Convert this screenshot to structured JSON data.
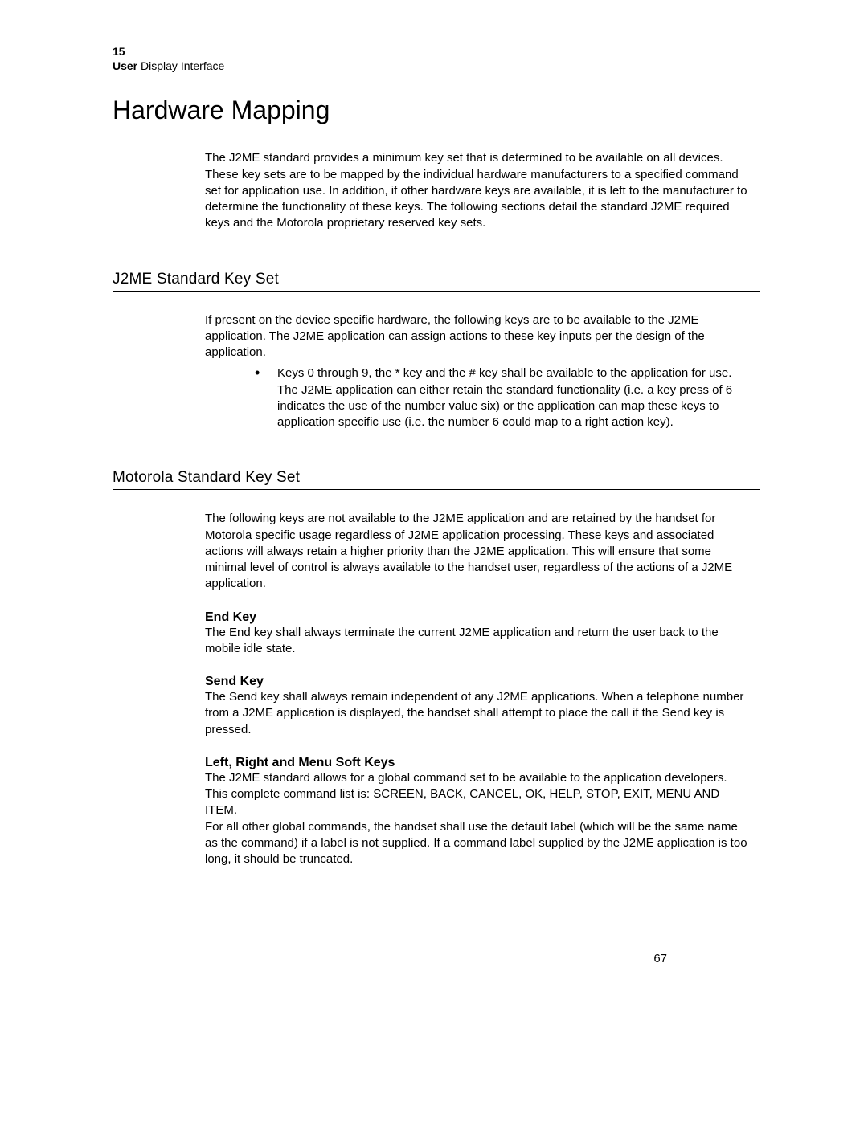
{
  "header": {
    "chapter_number": "15",
    "chapter_title_bold": "User",
    "chapter_title_rest": " Display Interface"
  },
  "title": "Hardware Mapping",
  "intro": "The J2ME standard provides a minimum key set that is determined to be available on all devices. These key sets are to be mapped by the individual hardware manufacturers to a specified command set for application use. In addition, if other hardware keys are available, it is left to the manufacturer to determine the functionality of these keys. The following sections detail the standard J2ME required keys and the Motorola proprietary reserved key sets.",
  "section_j2me": {
    "heading": "J2ME Standard Key Set",
    "para": "If present on the device specific hardware, the following keys are to be available to the J2ME application. The J2ME application can assign actions to these key inputs per the design of the application.",
    "bullet": "Keys 0 through 9, the * key and the # key shall be available to the application for use. The J2ME application can either retain the standard functionality (i.e. a key press of 6 indicates the use of the number value six) or the application can map these keys to application specific use (i.e. the number 6 could map to a right action key)."
  },
  "section_moto": {
    "heading": "Motorola Standard Key Set",
    "para": "The following keys are not available to the J2ME application and are retained by the handset for Motorola specific usage regardless of J2ME application processing. These keys and associated actions will always retain a higher priority than the J2ME application. This will ensure that some minimal level of control is always available to the handset user, regardless of the actions of a J2ME application.",
    "end_key": {
      "heading": "End Key",
      "para": "The End key shall always terminate the current J2ME application and return the user back to the mobile idle state."
    },
    "send_key": {
      "heading": "Send Key",
      "para": "The Send key shall always remain independent of any J2ME applications. When a telephone number from a J2ME application is displayed, the handset shall attempt to place the call if the Send key is pressed."
    },
    "soft_keys": {
      "heading": "Left, Right and Menu Soft Keys",
      "para1": "The J2ME standard allows for a global command set to be available to the application developers. This complete command list is: SCREEN, BACK, CANCEL, OK, HELP, STOP, EXIT, MENU AND ITEM.",
      "para2": "For all other global commands, the handset shall use the default label (which will be the same name as the command) if a label is not supplied. If a command label supplied by the J2ME application is too long, it should be truncated."
    }
  },
  "page_number": "67"
}
